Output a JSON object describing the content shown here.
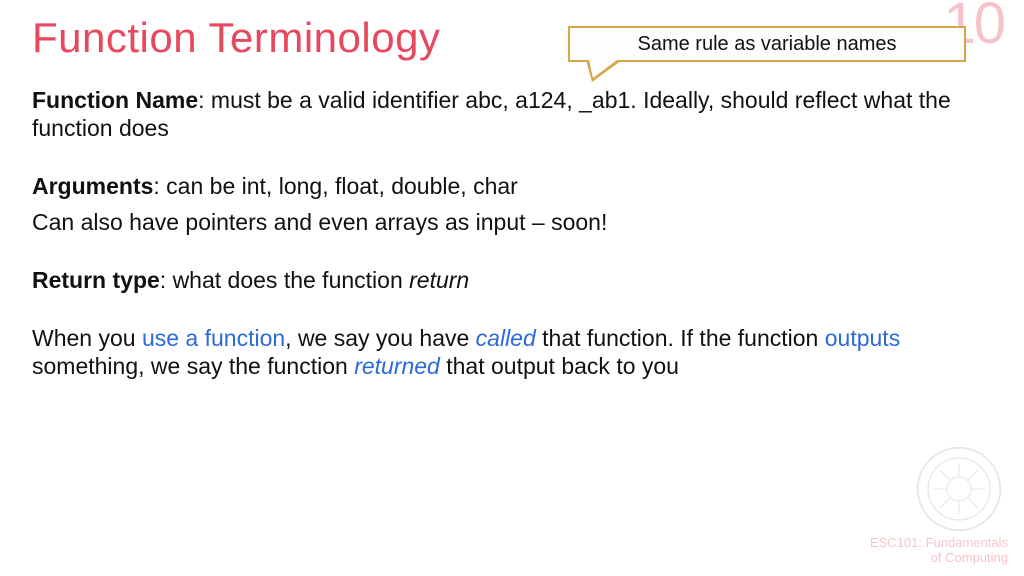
{
  "slide_number": "10",
  "title": "Function Terminology",
  "callout": "Same rule as variable names",
  "p1": {
    "label": "Function Name",
    "text": ": must be a valid identifier abc, a124, _ab1. Ideally, should reflect what the function does"
  },
  "p2": {
    "label": "Arguments",
    "text": ": can be int, long, float, double, char"
  },
  "p2b": "Can also have pointers and even arrays as input – soon!",
  "p3": {
    "label": "Return type",
    "text": ": what does the function ",
    "ital": "return"
  },
  "p4": {
    "a": "When you ",
    "b": "use a function",
    "c": ", we say you have ",
    "d": "called",
    "e": " that function. If the function ",
    "f": "outputs",
    "g": " something, we say the function ",
    "h": "returned",
    "i": " that output back to you"
  },
  "footer1": "ESC101: Fundamentals",
  "footer2": "of Computing"
}
